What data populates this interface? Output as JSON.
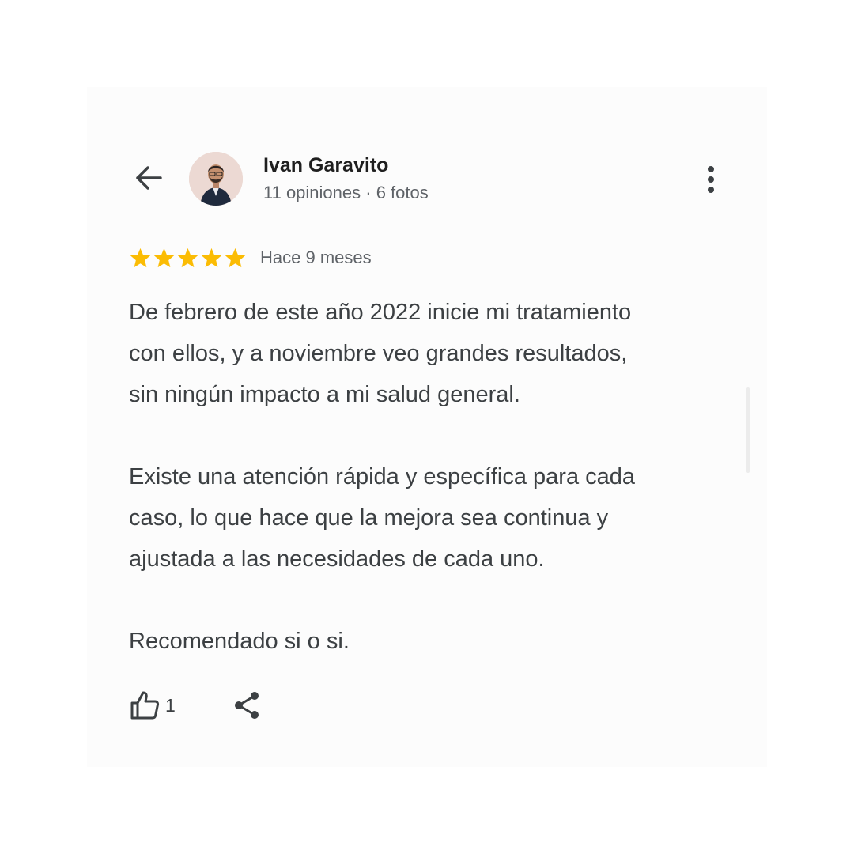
{
  "reviewer": {
    "name": "Ivan Garavito",
    "meta": "11 opiniones · 6 fotos"
  },
  "review": {
    "rating": 5,
    "rating_max": 5,
    "date": "Hace 9 meses",
    "paragraphs": [
      [
        "De febrero de este año 2022 inicie mi tratamiento",
        "con ellos, y a noviembre veo grandes resultados,",
        "sin ningún impacto a mi salud general."
      ],
      [
        "Existe una atención rápida y específica para cada",
        "caso, lo que hace que la mejora sea continua y",
        "ajustada a las necesidades de cada uno."
      ],
      [
        "Recomendado si o si."
      ]
    ],
    "likes": "1"
  },
  "icons": {
    "back": "arrow-back-icon",
    "more": "more-vert-icon",
    "like": "thumb-up-icon",
    "share": "share-icon",
    "star": "star-icon"
  },
  "colors": {
    "star": "#fbbc04",
    "text": "#3c4043",
    "secondary_text": "#5f6368",
    "name": "#1f1f1f"
  }
}
